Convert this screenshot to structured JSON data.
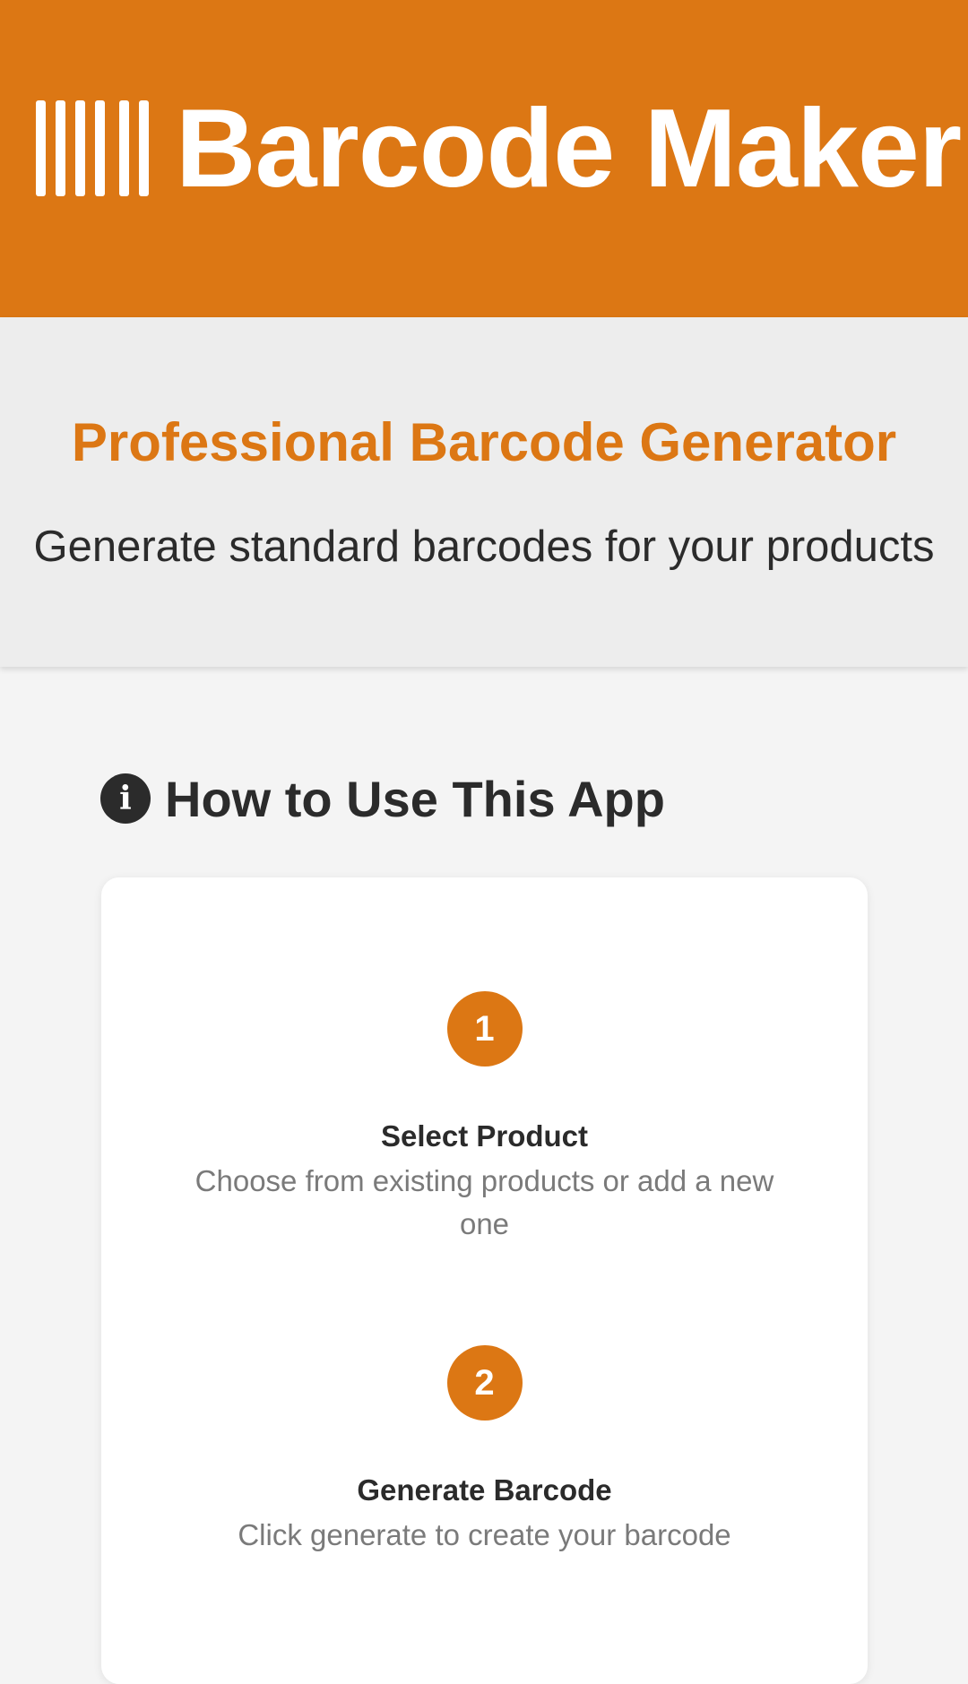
{
  "header": {
    "logo_icon": "barcode-icon",
    "title": "Barcode Maker",
    "background_color": "#dc7714"
  },
  "hero": {
    "title": "Professional Barcode Generator",
    "subtitle": "Generate standard barcodes for your products"
  },
  "how_to": {
    "icon": "info-icon",
    "icon_glyph": "i",
    "heading": "How to Use This App",
    "steps": [
      {
        "number": "1",
        "title": "Select Product",
        "description": "Choose from existing products or add a new one"
      },
      {
        "number": "2",
        "title": "Generate Barcode",
        "description": "Click generate to create your barcode"
      }
    ]
  }
}
